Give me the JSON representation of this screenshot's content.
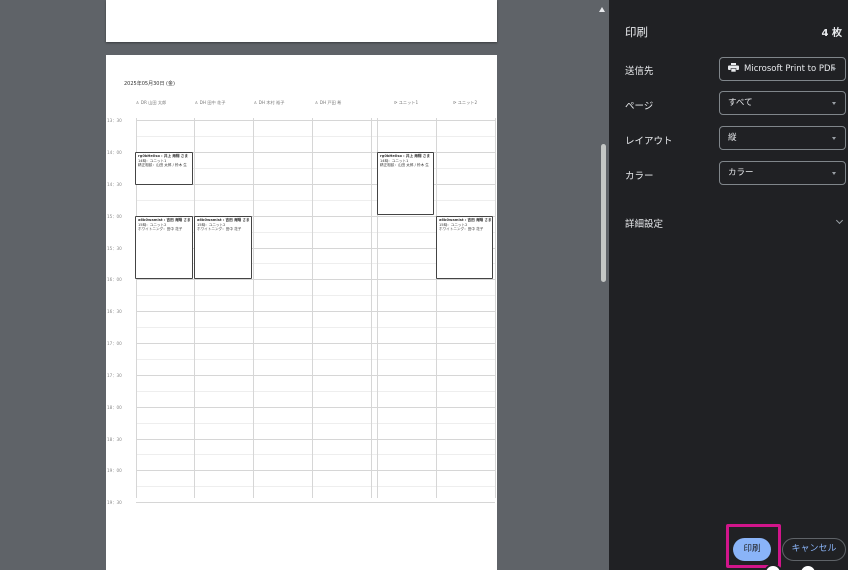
{
  "preview": {
    "date": "2025年05月30日 (金)",
    "columns": [
      "DR 山田 太郎",
      "DH 田中 花子",
      "DH 木村 裕子",
      "DH 戸田 希",
      "ユニット1",
      "ユニット2"
    ],
    "times": [
      "13：30",
      "14：00",
      "14：30",
      "15：00",
      "15：30",
      "16：00",
      "16：30",
      "17：00",
      "17：30",
      "18：00",
      "18：30",
      "19：00",
      "19：30"
    ],
    "appointments": [
      {
        "title": "rg0bHellso : 井上 海翔 さま",
        "line1": "14時：ユニット1",
        "line2": "精正相談：山田 太郎 / 鈴木 生"
      },
      {
        "title": "rg0bHellso : 井上 海翔 さま",
        "line1": "14時：ユニット1",
        "line2": "精正相談：山田 太郎 / 鈴木 生"
      },
      {
        "title": "a6b0wamist : 吉田 海翔 さま",
        "line1": "15時：ユニット2",
        "line2": "ホワイトニング：田中 花子"
      },
      {
        "title": "a6b0wamist : 吉田 海翔 さま",
        "line1": "15時：ユニット2",
        "line2": "ホワイトニング：田中 花子"
      },
      {
        "title": "a6b0wamist : 吉田 海翔 さま",
        "line1": "15時：ユニット2",
        "line2": "ホワイトニング：田中 花子"
      }
    ]
  },
  "panel": {
    "title": "印刷",
    "page_count": "4 枚",
    "destination_label": "送信先",
    "destination_value": "Microsoft Print to PDF",
    "pages_label": "ページ",
    "pages_value": "すべて",
    "layout_label": "レイアウト",
    "layout_value": "縦",
    "color_label": "カラー",
    "color_value": "カラー",
    "advanced_label": "詳細設定",
    "print_button": "印刷",
    "cancel_button": "キャンセル"
  },
  "colors": {
    "accent": "#8ab4f8",
    "highlight": "#d1158a",
    "panel_bg": "#202124",
    "preview_bg": "#5f6368"
  },
  "icons": [
    "printer-icon",
    "chevron-down-icon",
    "person-icon",
    "unit-icon"
  ]
}
